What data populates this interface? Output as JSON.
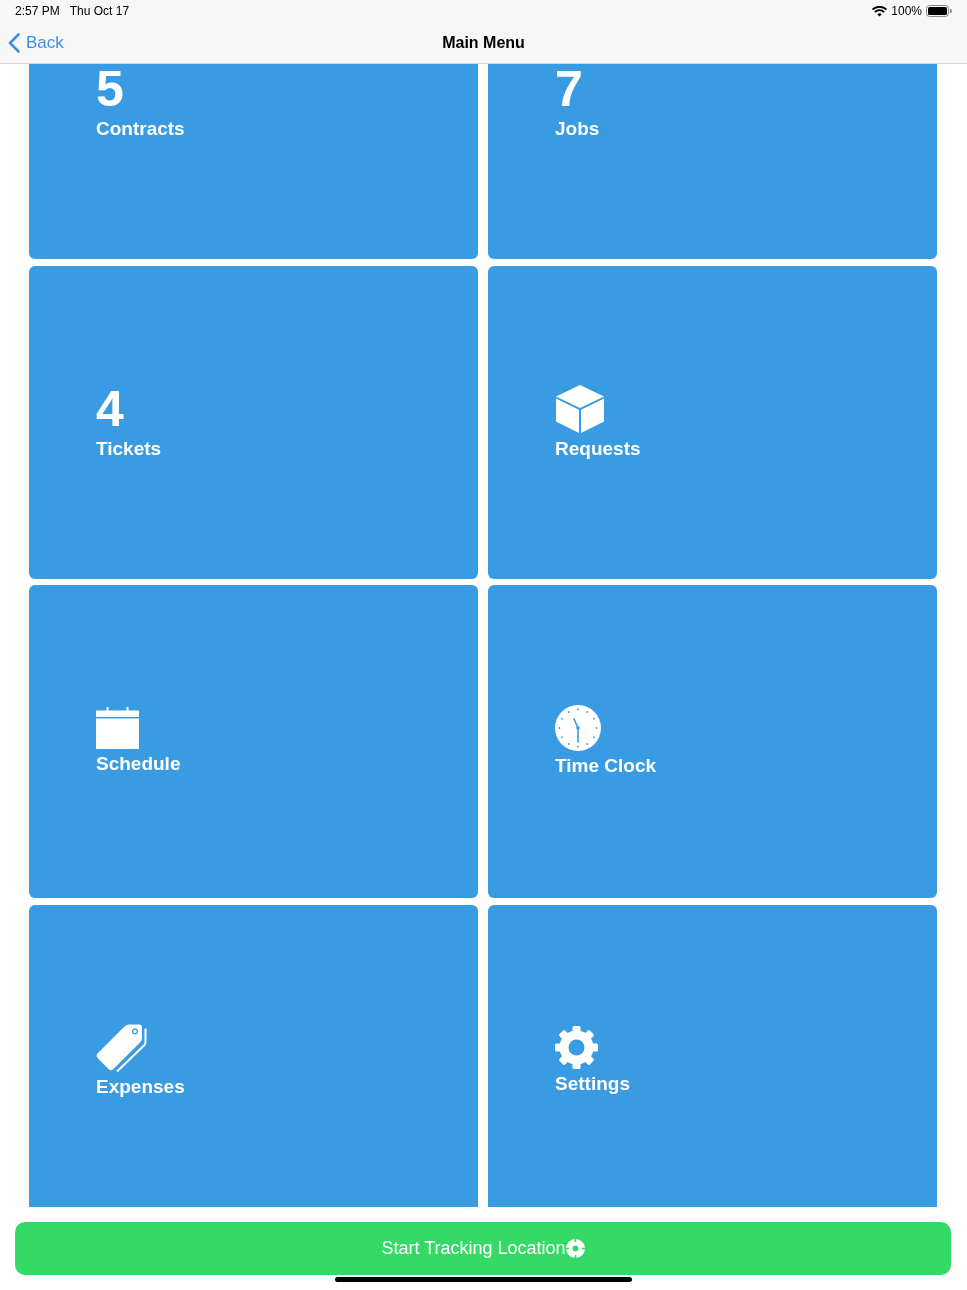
{
  "status_bar": {
    "time": "2:57 PM",
    "date": "Thu Oct 17",
    "battery": "100%"
  },
  "nav_bar": {
    "back": "Back",
    "title": "Main Menu"
  },
  "tiles": [
    {
      "kind": "count",
      "count": "5",
      "label": "Contracts"
    },
    {
      "kind": "count",
      "count": "7",
      "label": "Jobs"
    },
    {
      "kind": "count",
      "count": "4",
      "label": "Tickets"
    },
    {
      "kind": "icon",
      "label": "Requests"
    },
    {
      "kind": "icon",
      "label": "Schedule"
    },
    {
      "kind": "icon",
      "label": "Time Clock"
    },
    {
      "kind": "icon",
      "label": "Expenses"
    },
    {
      "kind": "icon",
      "label": "Settings"
    }
  ],
  "tracking_button": {
    "label": "Start Tracking Location"
  }
}
